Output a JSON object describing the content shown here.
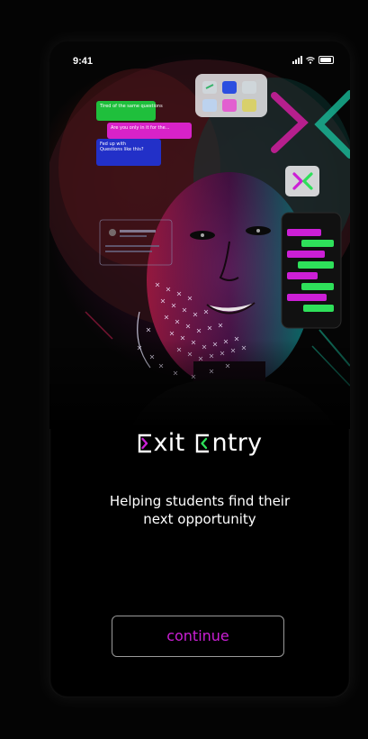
{
  "status_bar": {
    "time": "9:41"
  },
  "hero": {
    "bubbles": [
      "Tired of the same questions",
      "Are you only in it for the...",
      "Fed up with\nQuestions like this?"
    ]
  },
  "brand": {
    "name_part_1": "xit",
    "name_part_2": "ntry",
    "accent_color": "#cc1fd6",
    "accent_green": "#2ee05a"
  },
  "tagline": {
    "line1": "Helping students find their",
    "line2": "next opportunity"
  },
  "continue_button": {
    "label": "continue"
  }
}
